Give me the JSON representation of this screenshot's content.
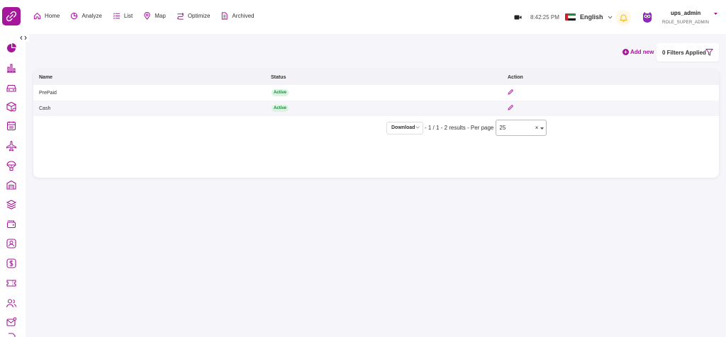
{
  "nav": [
    {
      "label": "Home",
      "icon": "home-icon"
    },
    {
      "label": "Analyze",
      "icon": "pie-chart-icon"
    },
    {
      "label": "List",
      "icon": "list-icon"
    },
    {
      "label": "Map",
      "icon": "map-pin-icon"
    },
    {
      "label": "Optimize",
      "icon": "route-icon"
    },
    {
      "label": "Archived",
      "icon": "archive-icon"
    }
  ],
  "header": {
    "time": "8:42:25 PM",
    "language": "English",
    "username": "ups_admin",
    "role": "ROLE_SUPER_ADMIN"
  },
  "actions": {
    "add_new": "Add new",
    "filters": "0 Filters Applied"
  },
  "table": {
    "columns": [
      "Name",
      "Status",
      "Action"
    ],
    "rows": [
      {
        "name": "PrePaid",
        "status": "Active"
      },
      {
        "name": "Cash",
        "status": "Active"
      }
    ]
  },
  "pagination": {
    "download": "Download",
    "summary": "- 1 / 1  - 2 results  - Per page",
    "per_page": "25"
  },
  "colors": {
    "brand": "#a6169a",
    "active_bg": "#d9f4e1",
    "active_text": "#1c8b3c"
  }
}
